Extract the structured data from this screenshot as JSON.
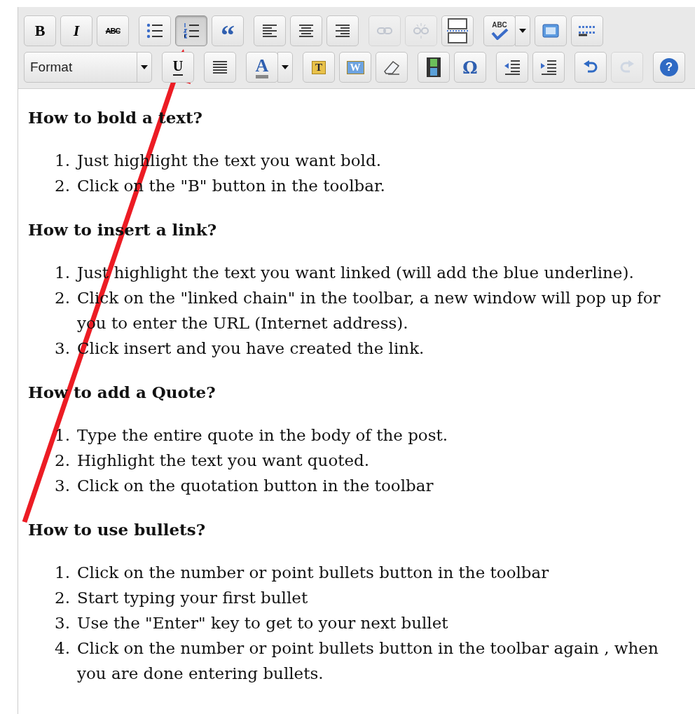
{
  "toolbar": [
    [
      [
        {
          "kind": "bold",
          "label": "B",
          "selected": false,
          "disabled": false
        },
        {
          "kind": "italic",
          "label": "I",
          "selected": false,
          "disabled": false
        },
        {
          "kind": "strike",
          "label": "ABC",
          "selected": false,
          "disabled": false
        }
      ],
      [
        {
          "kind": "bullet-list",
          "selected": false,
          "disabled": false
        },
        {
          "kind": "numbered-list",
          "selected": true,
          "disabled": false
        },
        {
          "kind": "quote",
          "label": "“",
          "selected": false,
          "disabled": false
        }
      ],
      [
        {
          "kind": "align-left",
          "selected": false,
          "disabled": false
        },
        {
          "kind": "align-center",
          "selected": false,
          "disabled": false
        },
        {
          "kind": "align-right",
          "selected": false,
          "disabled": false
        }
      ],
      [
        {
          "kind": "link",
          "selected": false,
          "disabled": true
        },
        {
          "kind": "unlink",
          "selected": false,
          "disabled": true
        },
        {
          "kind": "page-break",
          "selected": false,
          "disabled": false
        }
      ],
      [
        {
          "kind": "spellcheck",
          "label": "ABC",
          "selected": false,
          "disabled": false
        },
        {
          "kind": "menu-arrow",
          "selected": false,
          "disabled": false
        },
        {
          "kind": "window",
          "selected": false,
          "disabled": false
        },
        {
          "kind": "blocks",
          "selected": false,
          "disabled": false
        }
      ]
    ],
    [
      [
        {
          "kind": "select",
          "label": "Format",
          "selected": false,
          "disabled": false
        },
        {
          "kind": "menu-arrow",
          "selected": false,
          "disabled": false
        }
      ],
      [
        {
          "kind": "underline",
          "label": "U",
          "selected": false,
          "disabled": false
        }
      ],
      [
        {
          "kind": "justify",
          "selected": false,
          "disabled": false
        }
      ],
      [
        {
          "kind": "font-color",
          "label": "A",
          "selected": false,
          "disabled": false
        },
        {
          "kind": "menu-arrow",
          "selected": false,
          "disabled": false
        }
      ],
      [
        {
          "kind": "paste-text",
          "label": "T",
          "selected": false,
          "disabled": false
        },
        {
          "kind": "paste-word",
          "label": "W",
          "selected": false,
          "disabled": false
        },
        {
          "kind": "eraser",
          "selected": false,
          "disabled": false
        }
      ],
      [
        {
          "kind": "film",
          "selected": false,
          "disabled": false
        },
        {
          "kind": "omega",
          "label": "Ω",
          "selected": false,
          "disabled": false
        }
      ],
      [
        {
          "kind": "outdent",
          "selected": false,
          "disabled": false
        },
        {
          "kind": "indent",
          "selected": false,
          "disabled": false
        }
      ],
      [
        {
          "kind": "undo",
          "selected": false,
          "disabled": false
        },
        {
          "kind": "redo",
          "selected": false,
          "disabled": true
        }
      ],
      [
        {
          "kind": "help",
          "label": "?",
          "selected": false,
          "disabled": false
        }
      ]
    ]
  ],
  "sections": [
    {
      "heading": "How to bold a text?",
      "items": [
        {
          "number": "1.",
          "text": "Just highlight the text you want bold."
        },
        {
          "number": "2.",
          "text": "Click on the \"B\" button in the toolbar."
        }
      ]
    },
    {
      "heading": "How to insert a link?",
      "items": [
        {
          "number": "1.",
          "text": "Just highlight the text you want linked (will add the blue underline)."
        },
        {
          "number": "2.",
          "text": "Click on the \"linked chain\" in the toolbar, a new window will pop up for you to enter the URL (Internet address)."
        },
        {
          "number": "3.",
          "text": "Click insert and you have created the link."
        }
      ]
    },
    {
      "heading": "How to add a Quote?",
      "items": [
        {
          "number": "1.",
          "text": "Type the entire quote in the body of the post."
        },
        {
          "number": "2.",
          "text": "Highlight the text you want quoted."
        },
        {
          "number": "3.",
          "text": "Click on the quotation button in the toolbar"
        }
      ]
    },
    {
      "heading": "How to use bullets?",
      "items": [
        {
          "number": "1.",
          "text": "Click on the number or point bullets button in the toolbar"
        },
        {
          "number": "2.",
          "text": "Start typing your first bullet"
        },
        {
          "number": "3.",
          "text": "Use the \"Enter\" key to get to your next bullet"
        },
        {
          "number": "4.",
          "text": "Click on the number or point bullets button in the toolbar again , when you are done entering bullets."
        }
      ]
    }
  ]
}
